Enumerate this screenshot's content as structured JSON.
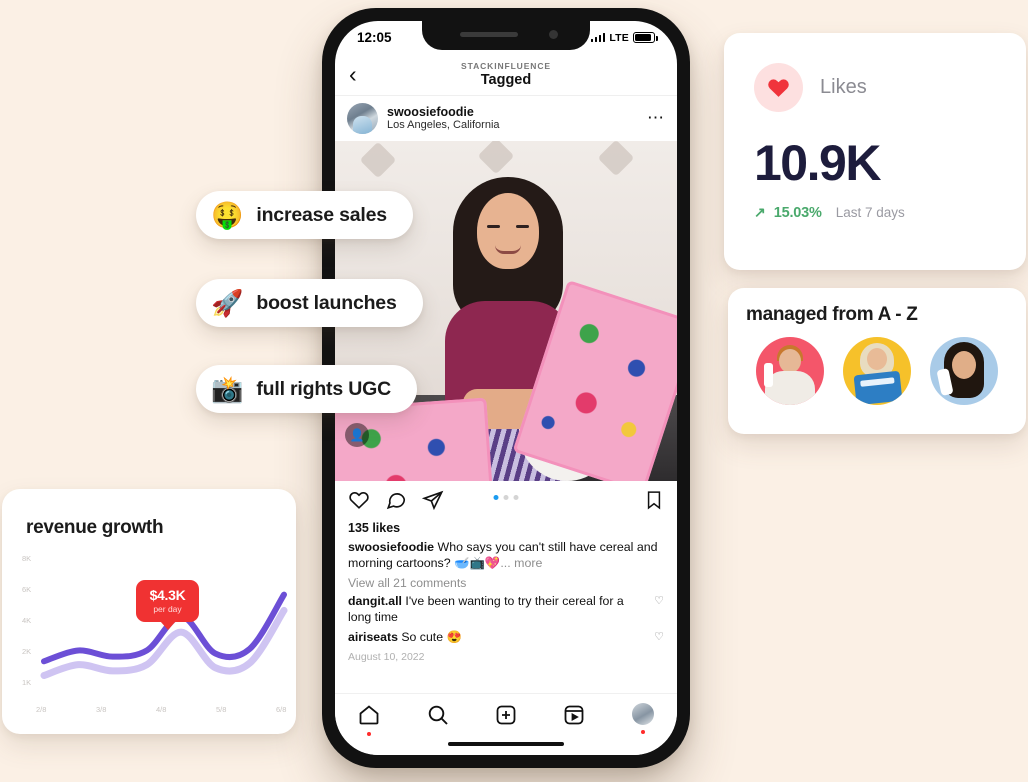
{
  "background_color": "#FBF0E5",
  "phone": {
    "status_bar": {
      "time": "12:05",
      "network": "LTE"
    },
    "ig_header": {
      "back_icon": "chevron-left-icon",
      "subtitle": "STACKINFLUENCE",
      "title": "Tagged"
    },
    "post_header": {
      "username": "swoosiefoodie",
      "location": "Los Angeles, California",
      "more_icon": "ellipsis-icon"
    },
    "post_photo": {
      "alt": "woman holding pink Magic Spoon cereal boxes with bowl of cereal",
      "tag_icon": "person-tag-icon"
    },
    "post_actions": {
      "like_icon": "heart-icon",
      "comment_icon": "comment-icon",
      "share_icon": "paper-plane-icon",
      "save_icon": "bookmark-icon",
      "carousel_dots": 3,
      "carousel_active_index": 0,
      "active_dot_color": "#1c9cf0"
    },
    "post_body": {
      "likes": "135 likes",
      "caption_user": "swoosiefoodie",
      "caption_text": " Who says you can't still have cereal and morning cartoons? 🥣📺💖",
      "caption_more": "... more",
      "view_comments": "View all 21 comments",
      "comments": [
        {
          "user": "dangit.all",
          "text": " I've been wanting to try their cereal for a long time",
          "like_icon": "heart-outline-icon"
        },
        {
          "user": "airiseats",
          "text": " So cute 😍",
          "like_icon": "heart-outline-icon"
        }
      ],
      "date": "August 10, 2022"
    },
    "nav": [
      {
        "name": "home",
        "icon": "home-icon",
        "badge": true
      },
      {
        "name": "search",
        "icon": "search-icon",
        "badge": false
      },
      {
        "name": "create",
        "icon": "plus-square-icon",
        "badge": false
      },
      {
        "name": "reels",
        "icon": "reels-icon",
        "badge": false
      },
      {
        "name": "profile",
        "icon": "profile-avatar-icon",
        "badge": true
      }
    ]
  },
  "pills": [
    {
      "emoji": "🤑",
      "emoji_name": "money-mouth-face-emoji",
      "label": "increase sales"
    },
    {
      "emoji": "🚀",
      "emoji_name": "rocket-emoji",
      "label": "boost launches"
    },
    {
      "emoji": "📸",
      "emoji_name": "camera-with-flash-emoji",
      "label": "full rights UGC"
    }
  ],
  "likes_card": {
    "icon": "heart-icon",
    "icon_color": "#F0343C",
    "icon_bubble_color": "#FDE0E0",
    "label": "Likes",
    "value": "10.9K",
    "value_color": "#1d1c3c",
    "trend_arrow": "↗",
    "trend_value": "15.03%",
    "trend_color": "#4aa96c",
    "period": "Last 7 days"
  },
  "managed_card": {
    "title": "managed from A - Z",
    "avatars": [
      {
        "name": "creator-avatar-1",
        "bg": "#F4566A"
      },
      {
        "name": "creator-avatar-2",
        "bg": "#F6C12A"
      },
      {
        "name": "creator-avatar-3",
        "bg": "#A9CBE8"
      }
    ]
  },
  "revenue_card": {
    "title": "revenue growth",
    "tooltip": {
      "value": "$4.3K",
      "unit": "per day",
      "color": "#F03232"
    }
  },
  "chart_data": {
    "type": "line",
    "title": "revenue growth",
    "xlabel": "",
    "ylabel": "",
    "x": [
      "2/8",
      "3/8",
      "4/8",
      "5/8",
      "6/8"
    ],
    "ytick_labels": [
      "8K",
      "6K",
      "4K",
      "2K",
      "1K"
    ],
    "ylim": [
      0,
      8000
    ],
    "grid": false,
    "legend": "none",
    "annotation": {
      "x": "4/8",
      "value": 4300,
      "label": "$4.3K per day"
    },
    "series": [
      {
        "name": "revenue",
        "color": "#6C4FD6",
        "values": [
          1400,
          2100,
          1700,
          2100,
          4300,
          1900,
          2200,
          5700
        ]
      },
      {
        "name": "revenue-shadow",
        "color": "#CFC4F2",
        "values": [
          1000,
          1700,
          1300,
          1700,
          3800,
          1500,
          1800,
          5200
        ]
      }
    ]
  }
}
